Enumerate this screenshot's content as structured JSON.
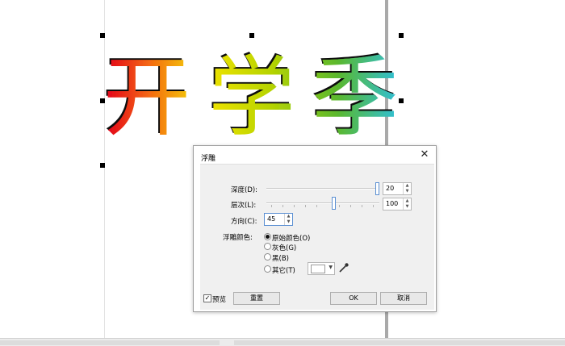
{
  "canvas": {
    "artwork_text": [
      "开",
      "学",
      "季"
    ]
  },
  "dialog": {
    "title": "浮雕",
    "close_symbol": "✕",
    "depth": {
      "label": "深度(D):",
      "value": "20",
      "slider_fraction": 1.0
    },
    "layers": {
      "label": "层次(L):",
      "value": "100",
      "slider_fraction": 0.6
    },
    "direction": {
      "label": "方向(C):",
      "value": "45"
    },
    "color": {
      "label": "浮雕颜色:",
      "options": [
        "原始颜色(O)",
        "灰色(G)",
        "黑(B)",
        "其它(T)"
      ],
      "selected": "原始颜色(O)",
      "other_swatch": "#ffffff"
    },
    "preview": {
      "label": "预览",
      "checked": true,
      "mark": "✓"
    },
    "reset_label": "重置",
    "ok_label": "OK",
    "cancel_label": "取消"
  }
}
